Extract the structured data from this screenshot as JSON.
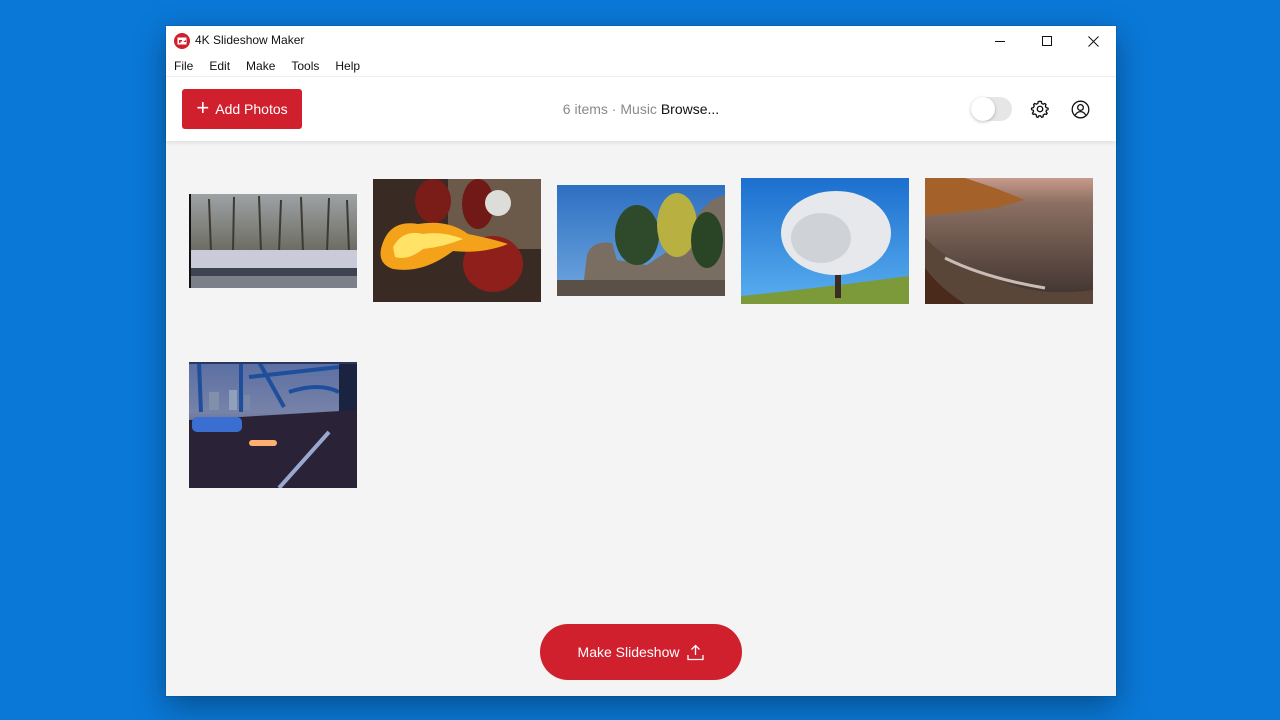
{
  "window": {
    "title": "4K Slideshow Maker",
    "controls": {
      "minimize": "minimize-icon",
      "maximize": "maximize-icon",
      "close": "close-icon"
    }
  },
  "menu": [
    "File",
    "Edit",
    "Make",
    "Tools",
    "Help"
  ],
  "toolbar": {
    "add_photos_label": "Add Photos",
    "items_count": "6 items",
    "separator": " · ",
    "music_label": "Music",
    "browse_label": "Browse...",
    "toggle_on": false,
    "settings_icon": "gear-icon",
    "account_icon": "user-circle-icon"
  },
  "photos": [
    {
      "name": "snowy-riverbank-trees"
    },
    {
      "name": "fire-breather"
    },
    {
      "name": "rocks-and-pines"
    },
    {
      "name": "blossoming-tree"
    },
    {
      "name": "rocky-coast-sunset"
    },
    {
      "name": "bridge-traffic-night"
    }
  ],
  "footer": {
    "make_slideshow_label": "Make Slideshow"
  },
  "colors": {
    "accent": "#d0202e",
    "desktop": "#0a78d7",
    "content_bg": "#f4f4f4"
  }
}
